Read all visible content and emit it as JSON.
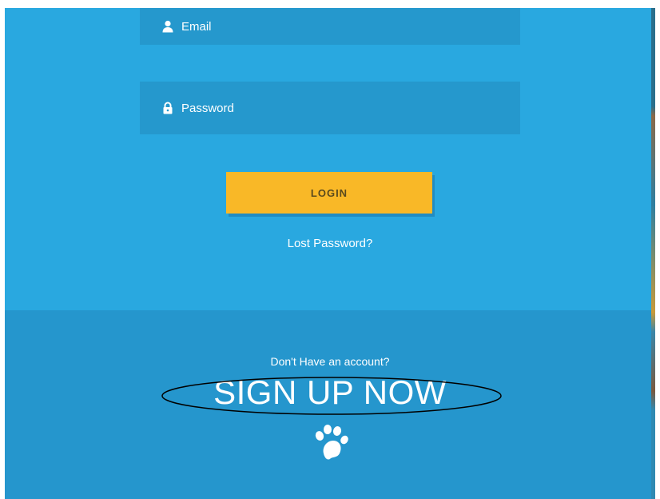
{
  "login_form": {
    "email_placeholder": "Email",
    "password_placeholder": "Password",
    "login_label": "LOGIN",
    "lost_password_label": "Lost Password?"
  },
  "signup": {
    "prompt": "Don't Have an account?",
    "cta_label": "SIGN UP NOW"
  },
  "icons": {
    "email": "user-icon",
    "password": "lock-icon",
    "footer": "paw-icon"
  },
  "colors": {
    "login_background": "#29a8e0",
    "signup_background": "#2596cd",
    "field_background": "#2598cd",
    "login_button": "#f9b827",
    "text": "#ffffff"
  }
}
